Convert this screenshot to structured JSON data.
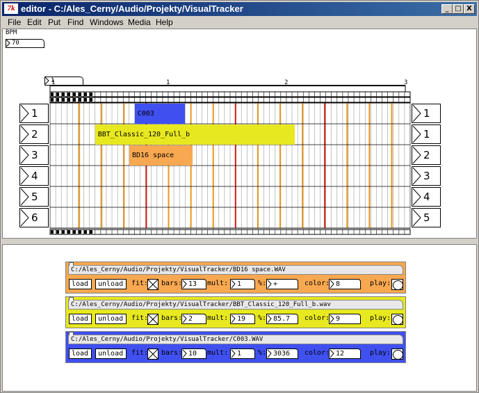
{
  "window": {
    "title": "editor  - C:/Ales_Cerny/Audio/Projekty/VisualTracker",
    "app_icon_text": "7k",
    "minimize": "_",
    "maximize": "□",
    "close": "X"
  },
  "menu": [
    "File",
    "Edit",
    "Put",
    "Find",
    "Windows",
    "Media",
    "Help"
  ],
  "bpm": {
    "label": "BPM",
    "value": "70"
  },
  "position": {
    "value": "1"
  },
  "ruler_labels": [
    "1",
    "1",
    "2",
    "3"
  ],
  "tracks_left": [
    "1",
    "2",
    "3",
    "4",
    "5",
    "6"
  ],
  "tracks_right": [
    "1",
    "1",
    "2",
    "3",
    "4",
    "5"
  ],
  "clips": [
    {
      "name": "C003",
      "track": 0,
      "start": 0.235,
      "length": 0.14,
      "color": "#4050f0"
    },
    {
      "name": "BBT_Classic_120_Full_b",
      "track": 1,
      "start": 0.125,
      "length": 0.555,
      "color": "#e8e820"
    },
    {
      "name": "BD16 space",
      "track": 2,
      "start": 0.22,
      "length": 0.175,
      "color": "#f8a850"
    }
  ],
  "panels": [
    {
      "path": "C:/Ales_Cerny/Audio/Projekty/VisualTracker/BD16 space.WAV",
      "load": "load",
      "unload": "unload",
      "fit_label": "fit:",
      "bars_label": "bars:",
      "bars": "13",
      "mult_label": "mult:",
      "mult": "1",
      "pct_label": "%:",
      "pct": "+",
      "color_label": "color:",
      "color": "8",
      "play_label": "play:",
      "bg": "#f8a850"
    },
    {
      "path": "C:/Ales_Cerny/Audio/Projekty/VisualTracker/BBT_Classic_120_Full_b.wav",
      "load": "load",
      "unload": "unload",
      "fit_label": "fit:",
      "bars_label": "bars:",
      "bars": "2",
      "mult_label": "mult:",
      "mult": "19",
      "pct_label": "%:",
      "pct": "85.7",
      "color_label": "color:",
      "color": "9",
      "play_label": "play:",
      "bg": "#e8e820"
    },
    {
      "path": "C:/Ales_Cerny/Audio/Projekty/VisualTracker/C003.WAV",
      "load": "load",
      "unload": "unload",
      "fit_label": "fit:",
      "bars_label": "bars:",
      "bars": "10",
      "mult_label": "mult:",
      "mult": "1",
      "pct_label": "%:",
      "pct": "3036",
      "color_label": "color:",
      "color": "12",
      "play_label": "play:",
      "bg": "#4050f0"
    }
  ],
  "colors": {
    "orange_line": "#e8961e",
    "red_line": "#d01818",
    "grid_line": "#999999"
  }
}
